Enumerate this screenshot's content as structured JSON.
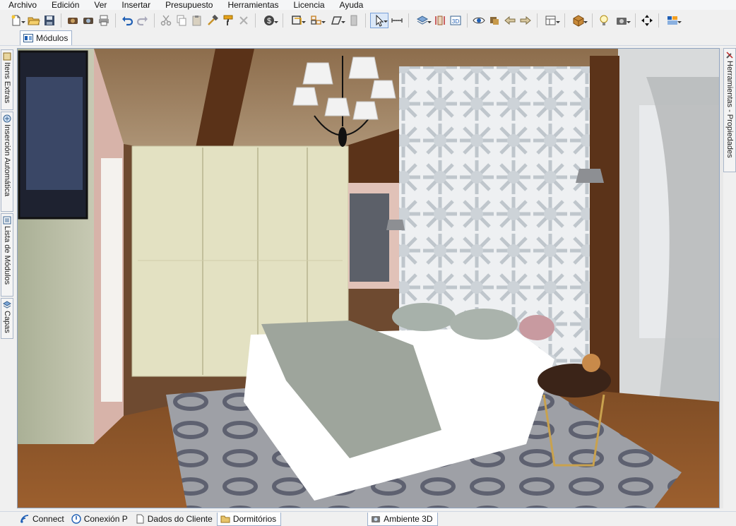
{
  "menu": [
    "Archivo",
    "Edición",
    "Ver",
    "Insertar",
    "Presupuesto",
    "Herramientas",
    "Licencia",
    "Ayuda"
  ],
  "toolbar": {
    "groups": [
      [
        "new-document-icon",
        "open-folder-icon",
        "save-icon"
      ],
      [
        "render-icon",
        "render-settings-icon",
        "print-icon"
      ],
      [
        "undo-icon",
        "redo-icon"
      ],
      [
        "cut-icon",
        "copy-icon",
        "paste-icon",
        "hammer-icon",
        "paint-roller-icon",
        "delete-icon"
      ],
      [
        "budget-icon"
      ],
      [
        "wall-tool-icon",
        "module-group-icon",
        "shape-icon",
        "door-icon"
      ],
      [
        "select-cursor-icon",
        "measure-icon"
      ],
      [
        "layers-icon",
        "dimension-icon",
        "view-3d-icon"
      ],
      [
        "eye-icon",
        "camera-paths-icon",
        "arrow-left-icon",
        "arrow-right-icon"
      ],
      [
        "view-layout-icon"
      ],
      [
        "box-3d-icon"
      ],
      [
        "light-bulb-icon",
        "camera-icon"
      ],
      [
        "move-icon"
      ],
      [
        "window-layout-icon"
      ]
    ]
  },
  "doc_tab": {
    "label": "Módulos",
    "icon": "modules-icon"
  },
  "left_dock": [
    {
      "label": "Itens Extras",
      "icon": "extras-icon"
    },
    {
      "label": "Inserción Automática",
      "icon": "auto-insert-icon"
    },
    {
      "label": "Lista de Módulos",
      "icon": "list-icon"
    },
    {
      "label": "Capas",
      "icon": "layers-icon"
    }
  ],
  "right_dock": {
    "label": "Herramientas - Propiedades",
    "icon": "tools-icon"
  },
  "viewport": {
    "title": "3D bedroom render"
  },
  "bottom_tabs": [
    {
      "label": "Connect",
      "icon": "connect-icon",
      "active": false
    },
    {
      "label": "Conexión P",
      "icon": "power-icon",
      "active": false
    },
    {
      "label": "Dados do Cliente",
      "icon": "document-icon",
      "active": false
    },
    {
      "label": "Dormitórios",
      "icon": "folder-icon",
      "active": true
    },
    {
      "label": "Ambiente 3D",
      "icon": "render-3d-icon",
      "active": true
    }
  ],
  "colors": {
    "accent": "#1f5fb5",
    "viewport_border": "#8fa3bf"
  }
}
